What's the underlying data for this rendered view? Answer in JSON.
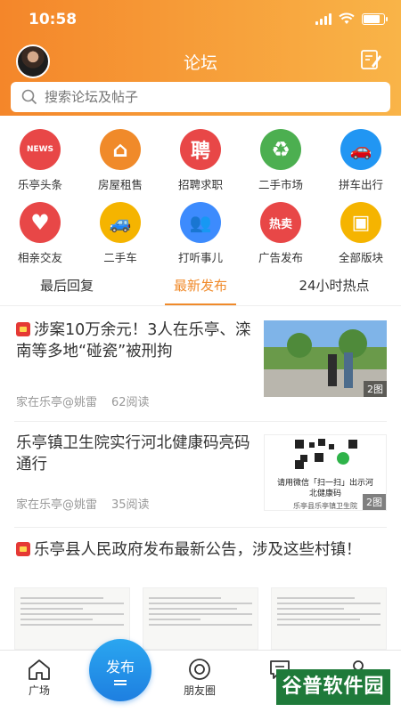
{
  "status": {
    "time": "10:58"
  },
  "header": {
    "title": "论坛"
  },
  "search": {
    "placeholder": "搜索论坛及帖子"
  },
  "categories": [
    {
      "label": "乐亭头条",
      "icon": "news-icon",
      "color": "#e84747"
    },
    {
      "label": "房屋租售",
      "icon": "house-icon",
      "color": "#f08a2a"
    },
    {
      "label": "招聘求职",
      "icon": "recruit-icon",
      "color": "#e84747"
    },
    {
      "label": "二手市场",
      "icon": "recycle-icon",
      "color": "#4caf50"
    },
    {
      "label": "拼车出行",
      "icon": "car-icon",
      "color": "#2196f3"
    },
    {
      "label": "相亲交友",
      "icon": "heart-icon",
      "color": "#e84747"
    },
    {
      "label": "二手车",
      "icon": "used-car-icon",
      "color": "#f5b400"
    },
    {
      "label": "打听事儿",
      "icon": "people-icon",
      "color": "#3d8bfd"
    },
    {
      "label": "广告发布",
      "icon": "ad-icon",
      "color": "#e84747"
    },
    {
      "label": "全部版块",
      "icon": "all-icon",
      "color": "#f5b400"
    }
  ],
  "category_glyphs": [
    "NEWS",
    "⌂",
    "聘",
    "♻",
    "🚗",
    "♥",
    "🚙",
    "👥",
    "热卖",
    "▣"
  ],
  "tabs": [
    "最后回复",
    "最新发布",
    "24小时热点"
  ],
  "posts": [
    {
      "title": "涉案10万余元！3人在乐亭、滦南等多地“碰瓷”被刑拘",
      "author": "家在乐亭@姚雷",
      "reads": "62阅读",
      "image_count": "2图"
    },
    {
      "title": "乐亭镇卫生院实行河北健康码亮码通行",
      "author": "家在乐亭@姚雷",
      "reads": "35阅读",
      "image_count": "2图",
      "qr_caption": "请用微信「扫一扫」出示河北健康码",
      "qr_footer": "乐亭县乐亭镇卫生院"
    },
    {
      "title": "乐亭县人民政府发布最新公告，涉及这些村镇！"
    }
  ],
  "bottom_nav": {
    "home": "广场",
    "publish": "发布",
    "friends": "朋友圈"
  },
  "watermark": "谷普软件园"
}
